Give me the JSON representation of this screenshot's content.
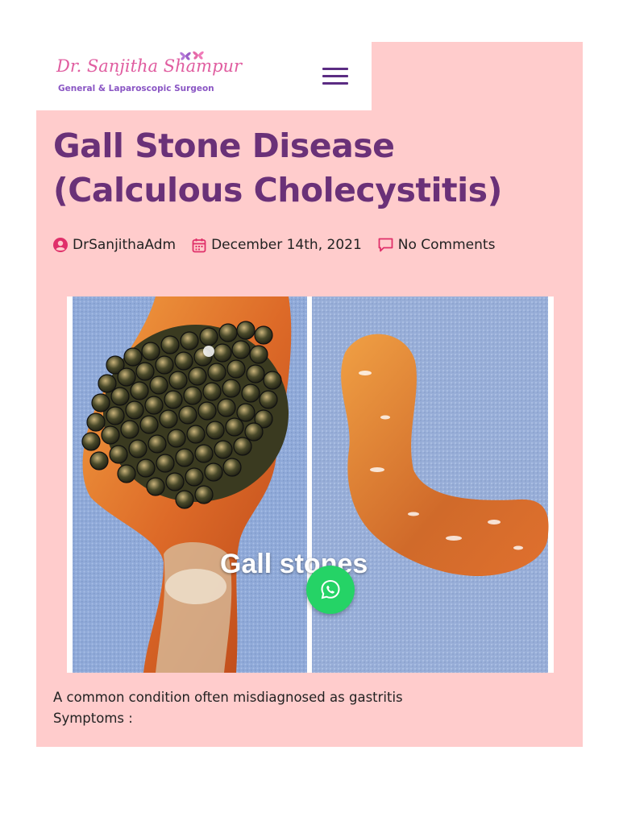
{
  "logo": {
    "name": "Dr. Sanjitha Shampur",
    "subtitle": "General & Laparoscopic Surgeon"
  },
  "menu": {
    "icon": "hamburger-menu-icon"
  },
  "post": {
    "title": "Gall Stone Disease (Calculous Cholecystitis)",
    "author": "DrSanjithaAdm",
    "date": "December 14th, 2021",
    "comments": "No Comments"
  },
  "image": {
    "caption": "Gall stones"
  },
  "content": {
    "paragraph": "A common condition often misdiagnosed as gastritis",
    "symptoms_label": "Symptoms :"
  },
  "colors": {
    "card_bg": "#ffcccc",
    "title": "#6a3178",
    "icon_accent": "#e0306a",
    "whatsapp": "#25d366"
  },
  "icons": {
    "author": "user-circle-icon",
    "date": "calendar-icon",
    "comments": "comment-bubble-icon",
    "chat": "whatsapp-icon"
  }
}
